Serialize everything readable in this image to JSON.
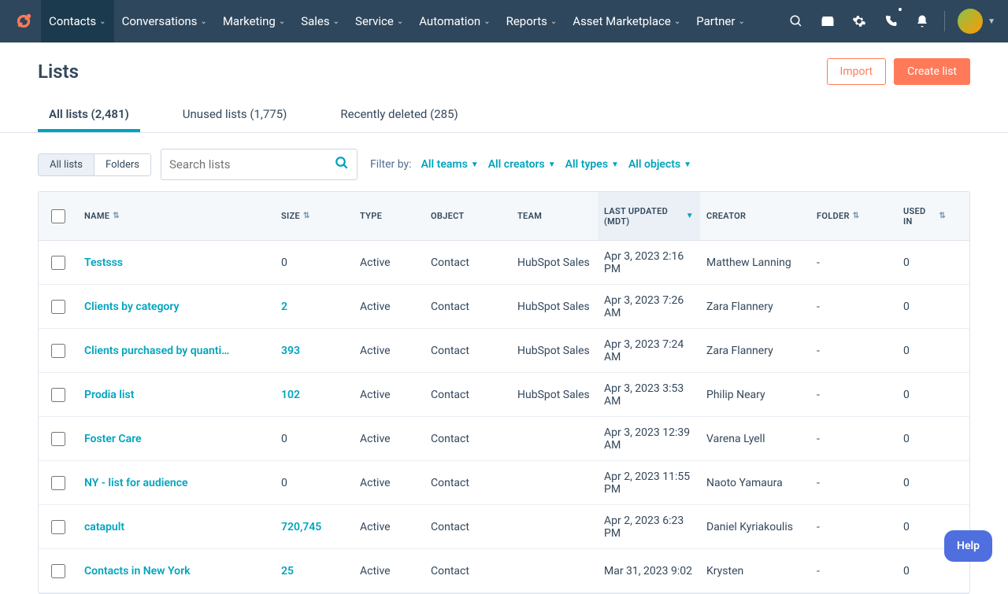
{
  "nav": {
    "items": [
      {
        "label": "Contacts",
        "active": true
      },
      {
        "label": "Conversations"
      },
      {
        "label": "Marketing"
      },
      {
        "label": "Sales"
      },
      {
        "label": "Service"
      },
      {
        "label": "Automation"
      },
      {
        "label": "Reports"
      },
      {
        "label": "Asset Marketplace"
      },
      {
        "label": "Partner"
      }
    ]
  },
  "page": {
    "title": "Lists",
    "import": "Import",
    "create": "Create list"
  },
  "tabs": [
    {
      "label": "All lists (2,481)",
      "active": true
    },
    {
      "label": "Unused lists (1,775)"
    },
    {
      "label": "Recently deleted (285)"
    }
  ],
  "viewToggle": {
    "all": "All lists",
    "folders": "Folders"
  },
  "search": {
    "placeholder": "Search lists"
  },
  "filters": {
    "label": "Filter by:",
    "teams": "All teams",
    "creators": "All creators",
    "types": "All types",
    "objects": "All objects"
  },
  "columns": {
    "name": "NAME",
    "size": "SIZE",
    "type": "TYPE",
    "object": "OBJECT",
    "team": "TEAM",
    "updated": "LAST UPDATED (MDT)",
    "creator": "CREATOR",
    "folder": "FOLDER",
    "used": "USED IN"
  },
  "rows": [
    {
      "name": "Testsss",
      "size": "0",
      "type": "Active",
      "object": "Contact",
      "team": "HubSpot Sales",
      "updated": "Apr 3, 2023 2:16 PM",
      "creator": "Matthew Lanning",
      "folder": "-",
      "used": "0",
      "sizelink": false
    },
    {
      "name": "Clients by category",
      "size": "2",
      "type": "Active",
      "object": "Contact",
      "team": "HubSpot Sales",
      "updated": "Apr 3, 2023 7:26 AM",
      "creator": "Zara Flannery",
      "folder": "-",
      "used": "0",
      "sizelink": true
    },
    {
      "name": "Clients purchased by quanti…",
      "size": "393",
      "type": "Active",
      "object": "Contact",
      "team": "HubSpot Sales",
      "updated": "Apr 3, 2023 7:24 AM",
      "creator": "Zara Flannery",
      "folder": "-",
      "used": "0",
      "sizelink": true
    },
    {
      "name": "Prodia list",
      "size": "102",
      "type": "Active",
      "object": "Contact",
      "team": "HubSpot Sales",
      "updated": "Apr 3, 2023 3:53 AM",
      "creator": "Philip Neary",
      "folder": "-",
      "used": "0",
      "sizelink": true
    },
    {
      "name": "Foster Care",
      "size": "0",
      "type": "Active",
      "object": "Contact",
      "team": "",
      "updated": "Apr 3, 2023 12:39 AM",
      "creator": "Varena Lyell",
      "folder": "-",
      "used": "0",
      "sizelink": false
    },
    {
      "name": "NY - list for audience",
      "size": "0",
      "type": "Active",
      "object": "Contact",
      "team": "",
      "updated": "Apr 2, 2023 11:55 PM",
      "creator": "Naoto Yamaura",
      "folder": "-",
      "used": "0",
      "sizelink": false
    },
    {
      "name": "catapult",
      "size": "720,745",
      "type": "Active",
      "object": "Contact",
      "team": "",
      "updated": "Apr 2, 2023 6:23 PM",
      "creator": "Daniel Kyriakoulis",
      "folder": "-",
      "used": "0",
      "sizelink": true
    },
    {
      "name": "Contacts in New York",
      "size": "25",
      "type": "Active",
      "object": "Contact",
      "team": "",
      "updated": "Mar 31, 2023 9:02",
      "creator": "Krysten",
      "folder": "-",
      "used": "0",
      "sizelink": true
    }
  ],
  "help": "Help"
}
